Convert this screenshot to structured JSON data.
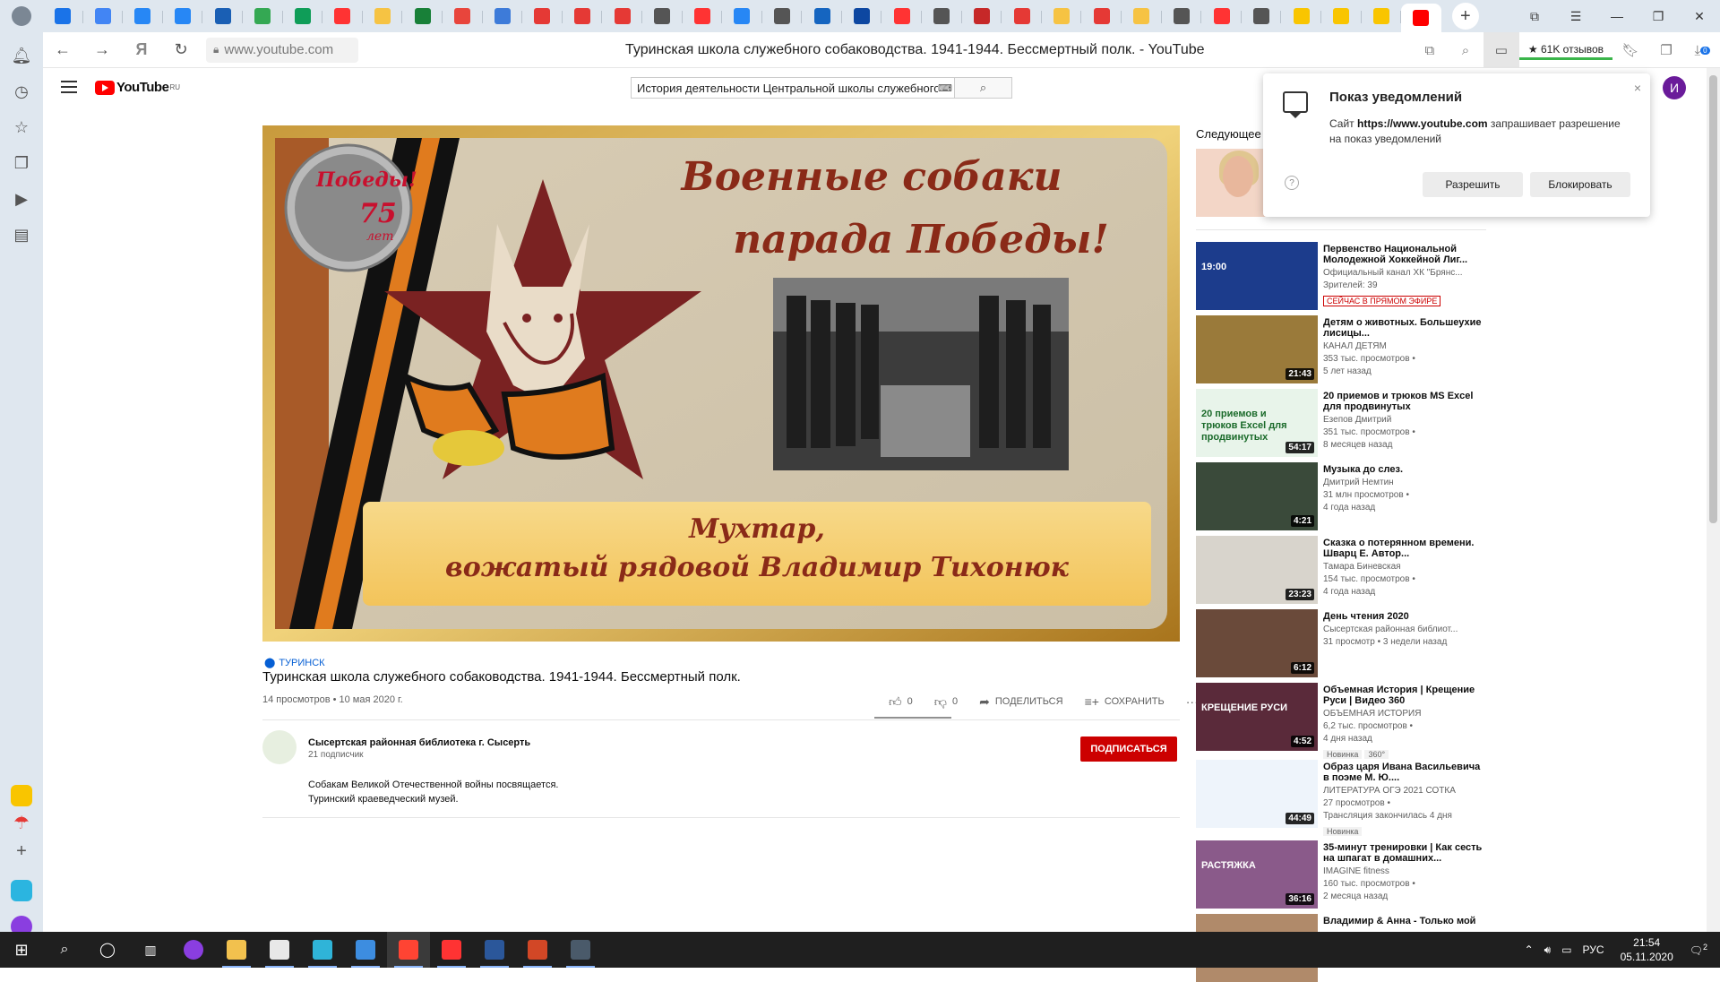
{
  "browser": {
    "tabs": [
      {
        "icon": "messenger-icon",
        "color": "#1a73e8"
      },
      {
        "icon": "docs-icon",
        "color": "#4285f4"
      },
      {
        "icon": "vk-icon",
        "color": "#2787f5"
      },
      {
        "icon": "vk-icon",
        "color": "#2787f5"
      },
      {
        "icon": "calendar-icon",
        "color": "#1a5fb4"
      },
      {
        "icon": "drive-icon",
        "color": "#34a853"
      },
      {
        "icon": "sheets-plus-icon",
        "color": "#0f9d58"
      },
      {
        "icon": "yandex-icon",
        "color": "#ff3333"
      },
      {
        "icon": "pencil-icon",
        "color": "#f6c343"
      },
      {
        "icon": "sheets-icon",
        "color": "#188038"
      },
      {
        "icon": "multicolor-icon",
        "color": "#e8453c"
      },
      {
        "icon": "blue-app-icon",
        "color": "#3d7bd9"
      },
      {
        "icon": "pdf-icon",
        "color": "#e53935"
      },
      {
        "icon": "red-circle-icon",
        "color": "#e53935"
      },
      {
        "icon": "pdf-icon",
        "color": "#e53935"
      },
      {
        "icon": "document-icon",
        "color": "#555555"
      },
      {
        "icon": "yandex-icon",
        "color": "#ff3333"
      },
      {
        "icon": "vk-icon",
        "color": "#2787f5"
      },
      {
        "icon": "document-icon",
        "color": "#555555"
      },
      {
        "icon": "mail-at-icon",
        "color": "#1565c0"
      },
      {
        "icon": "mail-icon",
        "color": "#0d47a1"
      },
      {
        "icon": "yandex-icon",
        "color": "#ff3333"
      },
      {
        "icon": "document-icon",
        "color": "#555555"
      },
      {
        "icon": "feather-icon",
        "color": "#c62828"
      },
      {
        "icon": "pdf-icon",
        "color": "#e53935"
      },
      {
        "icon": "pencil-icon",
        "color": "#f6c343"
      },
      {
        "icon": "pdf-icon",
        "color": "#e53935"
      },
      {
        "icon": "pencil-icon",
        "color": "#f6c343"
      },
      {
        "icon": "document-icon",
        "color": "#555555"
      },
      {
        "icon": "yandex-icon",
        "color": "#ff3333"
      },
      {
        "icon": "document-icon",
        "color": "#555555"
      },
      {
        "icon": "yandex-play-icon",
        "color": "#f9c500"
      },
      {
        "icon": "yandex-play-icon",
        "color": "#f9c500"
      },
      {
        "icon": "yandex-play-icon",
        "color": "#f9c500"
      },
      {
        "icon": "youtube-icon",
        "color": "#ff0000",
        "active": true
      }
    ],
    "new_tab": "+",
    "url": "www.youtube.com",
    "page_title": "Туринская школа служебного собаководства. 1941-1944. Бессмертный полк. - YouTube",
    "reviews": "★ 61K отзывов",
    "download_badge": "0"
  },
  "youtube": {
    "region": "RU",
    "search_query": "История деятельности Центральной школы служебного собаководства",
    "avatar_letter": "И"
  },
  "video": {
    "thumbnail_text_top_line1": "Военные собаки",
    "thumbnail_text_top_line2": "парада Победы!",
    "thumbnail_text_bottom_line1": "Мухтар,",
    "thumbnail_text_bottom_line2": "вожатый рядовой Владимир Тихонюк",
    "badge_line1": "Победы!",
    "badge_line2": "75",
    "badge_line3": "лет",
    "location": "ТУРИНСК",
    "title": "Туринская школа служебного собаководства. 1941-1944. Бессмертный полк.",
    "meta": "14 просмотров • 10 мая 2020 г.",
    "likes": "0",
    "dislikes": "0",
    "share": "ПОДЕЛИТЬСЯ",
    "save": "СОХРАНИТЬ",
    "more": "···",
    "channel_name": "Сысертская районная библиотека г. Сысерть",
    "subscribers": "21 подписчик",
    "subscribe": "ПОДПИСАТЬСЯ",
    "description_line1": "Собакам Великой Отечественной войны посвящается.",
    "description_line2": "Туринский краеведческий музей."
  },
  "sidebar": {
    "up_next": "Следующее",
    "items": [
      {
        "title": "Первенство Национальной Молодежной Хоккейной Лиг...",
        "channel": "Официальный канал ХК \"Брянс...",
        "views": "Зрителей: 39",
        "live": "СЕЙЧАС В ПРЯМОМ ЭФИРЕ",
        "bg": "#1c3c8c",
        "thumb_text": "19:00"
      },
      {
        "title": "Детям о животных. Большеухие лисицы...",
        "channel": "КАНАЛ ДЕТЯМ",
        "views": "353 тыс. просмотров •",
        "age": "5 лет назад",
        "duration": "21:43",
        "bg": "#9a7a3a"
      },
      {
        "title": "20 приемов и трюков MS Excel для продвинутых",
        "channel": "Езепов Дмитрий",
        "views": "351 тыс. просмотров •",
        "age": "8 месяцев назад",
        "duration": "54:17",
        "bg": "#e8f4ea",
        "thumb_text": "20 приемов и трюков Excel для продвинутых"
      },
      {
        "title": "Музыка до слез.",
        "channel": "Дмитрий Немтин",
        "views": "31 млн просмотров •",
        "age": "4 года назад",
        "duration": "4:21",
        "bg": "#3a4a3a"
      },
      {
        "title": "Сказка о потерянном времени. Шварц Е. Автор...",
        "channel": "Тамара Биневская",
        "views": "154 тыс. просмотров •",
        "age": "4 года назад",
        "duration": "23:23",
        "bg": "#d8d4cc"
      },
      {
        "title": "День чтения 2020",
        "channel": "Сысертская районная библиот...",
        "views": "31 просмотр • 3 недели назад",
        "duration": "6:12",
        "bg": "#6a4a3a"
      },
      {
        "title": "Объемная История | Крещение Руси | Видео 360",
        "channel": "ОБЪЕМНАЯ ИСТОРИЯ",
        "views": "6,2 тыс. просмотров •",
        "age": "4 дня назад",
        "badges": [
          "Новинка",
          "360°"
        ],
        "duration": "4:52",
        "bg": "#5a2a3a",
        "thumb_text": "КРЕЩЕНИЕ РУСИ"
      },
      {
        "title": "Образ царя Ивана Васильевича в поэме М. Ю....",
        "channel": "ЛИТЕРАТУРА ОГЭ 2021 СОТКА",
        "views": "27 просмотров •",
        "age": "Трансляция закончилась 4 дня",
        "badges": [
          "Новинка"
        ],
        "duration": "44:49",
        "bg": "#eef4fb"
      },
      {
        "title": "35-минут тренировки | Как сесть на шпагат в домашних...",
        "channel": "IMAGINE fitness",
        "views": "160 тыс. просмотров •",
        "age": "2 месяца назад",
        "duration": "36:16",
        "bg": "#8a5a8a",
        "thumb_text": "РАСТЯЖКА"
      },
      {
        "title": "Владимир & Анна - Только мой",
        "channel": "",
        "views": "",
        "bg": "#b08a6a"
      }
    ]
  },
  "notification": {
    "title": "Показ уведомлений",
    "text_prefix": "Сайт ",
    "site": "https://www.youtube.com",
    "text_suffix": " запрашивает разрешение на показ уведомлений",
    "allow": "Разрешить",
    "block": "Блокировать",
    "help": "?",
    "close": "×"
  },
  "taskbar": {
    "lang": "РУС",
    "time": "21:54",
    "date": "05.11.2020",
    "notif_count": "2",
    "apps": [
      {
        "name": "file-explorer-icon",
        "color": "#f2c14e"
      },
      {
        "name": "store-icon",
        "color": "#e8e8e8"
      },
      {
        "name": "edge-icon",
        "color": "#2fb4d8"
      },
      {
        "name": "mail-icon",
        "color": "#3d8de0"
      },
      {
        "name": "yandex-browser-icon",
        "color": "#ff4433"
      },
      {
        "name": "yandex-icon",
        "color": "#ff3333"
      },
      {
        "name": "word-icon",
        "color": "#2b579a"
      },
      {
        "name": "powerpoint-icon",
        "color": "#d24726"
      },
      {
        "name": "calculator-icon",
        "color": "#4a5a6a"
      }
    ]
  }
}
